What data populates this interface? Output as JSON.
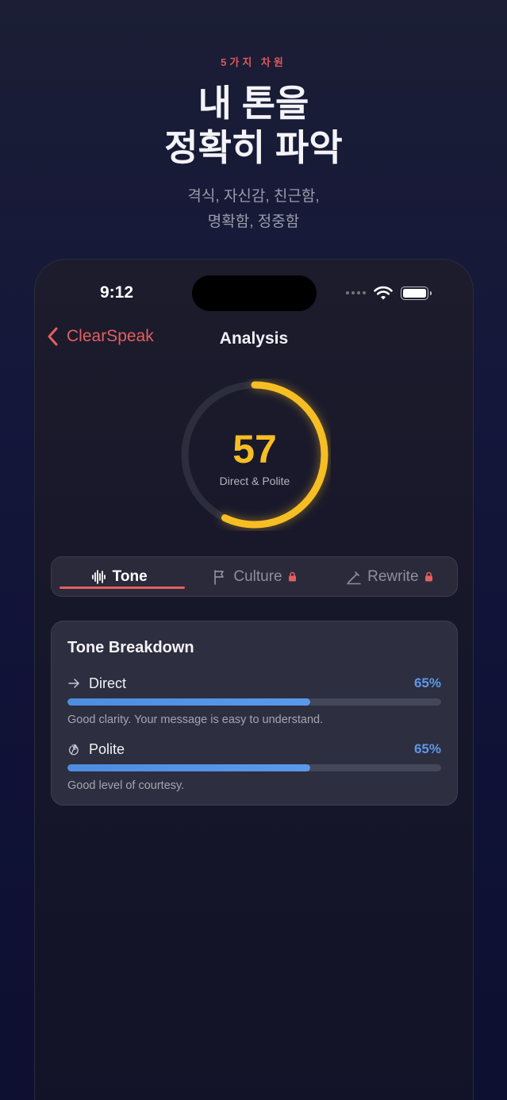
{
  "promo": {
    "eyebrow": "5가지 차원",
    "headline_line1": "내 톤을",
    "headline_line2": "정확히 파악",
    "sub_line1": "격식, 자신감, 친근함,",
    "sub_line2": "명확함, 정중함"
  },
  "status_bar": {
    "time": "9:12"
  },
  "nav": {
    "back_label": "ClearSpeak",
    "title": "Analysis"
  },
  "score": {
    "value": "57",
    "label": "Direct & Polite",
    "fraction": 0.57,
    "color": "#f7be24"
  },
  "tabs": [
    {
      "label": "Tone",
      "icon": "waveform-icon",
      "active": true,
      "locked": false
    },
    {
      "label": "Culture",
      "icon": "flag-icon",
      "active": false,
      "locked": true
    },
    {
      "label": "Rewrite",
      "icon": "pencil-icon",
      "active": false,
      "locked": true
    }
  ],
  "breakdown": {
    "title": "Tone Breakdown",
    "metrics": [
      {
        "name": "Direct",
        "icon": "arrow-right-icon",
        "percent": "65%",
        "fraction": 0.65,
        "description": "Good clarity. Your message is easy to understand."
      },
      {
        "name": "Polite",
        "icon": "hand-wave-icon",
        "percent": "65%",
        "fraction": 0.65,
        "description": "Good level of courtesy."
      }
    ]
  },
  "colors": {
    "accent": "#e35f5f",
    "score": "#f7be24",
    "bar": "#5c98e6"
  }
}
